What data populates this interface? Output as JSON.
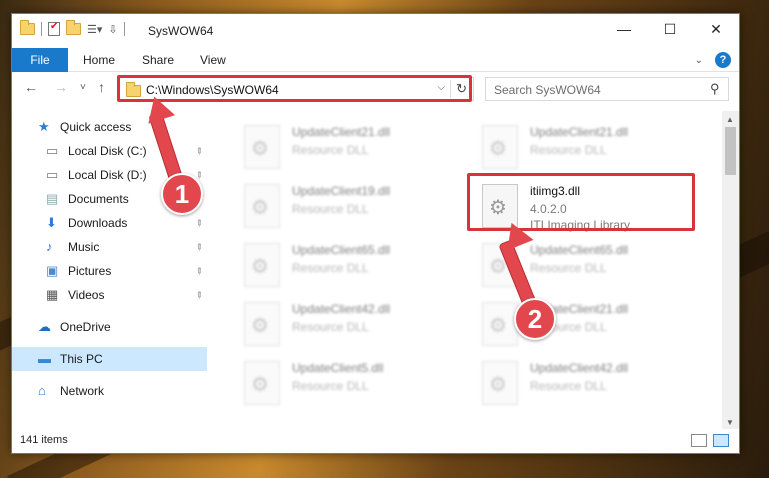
{
  "window": {
    "title": "SysWOW64"
  },
  "titlebar": {
    "minimize_glyph": "—",
    "maximize_glyph": "☐",
    "close_glyph": "✕"
  },
  "ribbon": {
    "tabs": [
      {
        "label": "File"
      },
      {
        "label": "Home"
      },
      {
        "label": "Share"
      },
      {
        "label": "View"
      }
    ],
    "help_glyph": "?"
  },
  "nav": {
    "back_glyph": "←",
    "forward_glyph": "→",
    "recent_glyph": "˅",
    "up_glyph": "↑",
    "address": "C:\\Windows\\SysWOW64",
    "address_dropdown_glyph": "⌵",
    "refresh_glyph": "↻",
    "search_placeholder": "Search SysWOW64",
    "search_glyph": "⚲"
  },
  "sidebar": {
    "items": [
      {
        "label": "Quick access",
        "icon": "star-icon",
        "pinned": false
      },
      {
        "label": "Local Disk (C:)",
        "icon": "drive-icon",
        "pinned": true
      },
      {
        "label": "Local Disk (D:)",
        "icon": "drive-icon",
        "pinned": true
      },
      {
        "label": "Documents",
        "icon": "documents-icon",
        "pinned": true
      },
      {
        "label": "Downloads",
        "icon": "download-icon",
        "pinned": true
      },
      {
        "label": "Music",
        "icon": "music-icon",
        "pinned": true
      },
      {
        "label": "Pictures",
        "icon": "pictures-icon",
        "pinned": true
      },
      {
        "label": "Videos",
        "icon": "videos-icon",
        "pinned": true
      },
      {
        "label": "OneDrive",
        "icon": "cloud-icon",
        "pinned": false
      },
      {
        "label": "This PC",
        "icon": "computer-icon",
        "pinned": false,
        "selected": true
      },
      {
        "label": "Network",
        "icon": "network-icon",
        "pinned": false
      }
    ],
    "pin_glyph": "📌"
  },
  "files": [
    {
      "name": "UpdateClient21.dll",
      "desc": "Resource DLL",
      "blurred": true
    },
    {
      "name": "UpdateClient21.dll",
      "desc": "Resource DLL",
      "blurred": true
    },
    {
      "name": "UpdateClient19.dll",
      "desc": "Resource DLL",
      "blurred": true
    },
    {
      "name": "itiimg3.dll",
      "version": "4.0.2.0",
      "desc": "ITI Imaging Library",
      "blurred": false
    },
    {
      "name": "UpdateClient65.dll",
      "desc": "Resource DLL",
      "blurred": true
    },
    {
      "name": "UpdateClient65.dll",
      "desc": "Resource DLL",
      "blurred": true
    },
    {
      "name": "UpdateClient42.dll",
      "desc": "Resource DLL",
      "blurred": true
    },
    {
      "name": "UpdateClient21.dll",
      "desc": "Resource DLL",
      "blurred": true
    },
    {
      "name": "UpdateClient5.dll",
      "desc": "Resource DLL",
      "blurred": true
    },
    {
      "name": "UpdateClient42.dll",
      "desc": "Resource DLL",
      "blurred": true
    }
  ],
  "file_icon_glyph": "⚙",
  "status": {
    "item_count": "141 items"
  },
  "annotations": {
    "step1": "1",
    "step2": "2",
    "color": "#d9333a"
  }
}
